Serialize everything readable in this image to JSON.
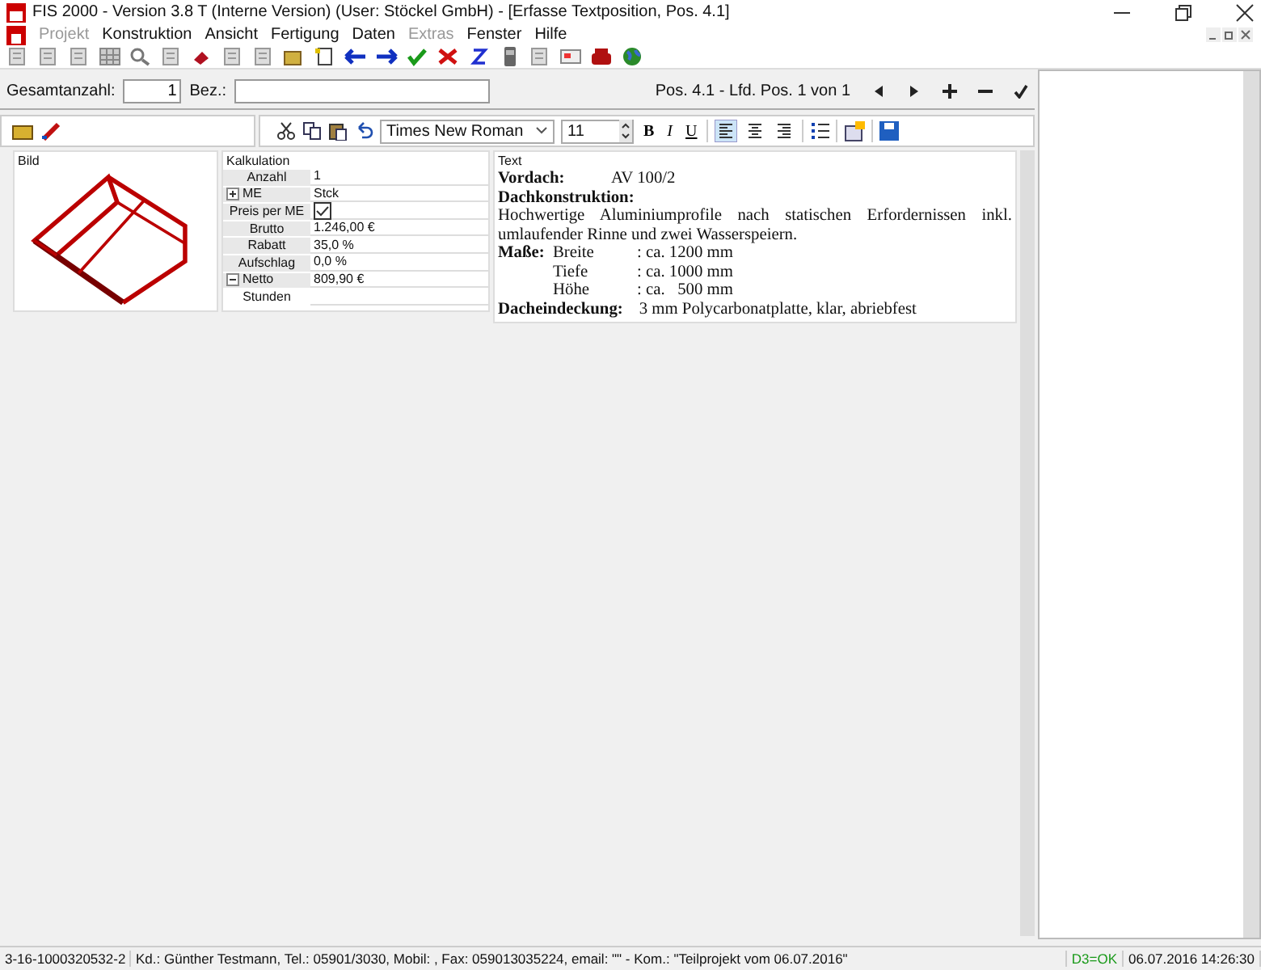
{
  "window": {
    "title": "FIS 2000 - Version 3.8 T (Interne Version) (User: Stöckel GmbH) - [Erfasse Textposition, Pos. 4.1]"
  },
  "menu": [
    {
      "label": "Projekt",
      "disabled": true
    },
    {
      "label": "Konstruktion",
      "disabled": false
    },
    {
      "label": "Ansicht",
      "disabled": false
    },
    {
      "label": "Fertigung",
      "disabled": false
    },
    {
      "label": "Daten",
      "disabled": false
    },
    {
      "label": "Extras",
      "disabled": true
    },
    {
      "label": "Fenster",
      "disabled": false
    },
    {
      "label": "Hilfe",
      "disabled": false
    }
  ],
  "form": {
    "quantity_label": "Gesamtanzahl:",
    "quantity_value": "1",
    "name_label": "Bez.:",
    "position": "Pos. 4.1 - Lfd. Pos. 1 von 1"
  },
  "format_toolbar": {
    "font": "Times New Roman",
    "size": "11",
    "styles": [
      {
        "label": "B",
        "kind": "bold"
      },
      {
        "label": "I",
        "kind": "italic"
      },
      {
        "label": "U",
        "kind": "underline"
      }
    ],
    "alignment": [
      {
        "selected": true
      },
      {
        "selected": false
      },
      {
        "selected": false
      }
    ]
  },
  "panels": {
    "image_title": "Bild",
    "calc_title": "Kalkulation",
    "text_title": "Text"
  },
  "calculation": [
    {
      "label": "Anzahl",
      "value": "1",
      "kind": "text"
    },
    {
      "label": "ME",
      "value": "Stck",
      "kind": "group",
      "expanded": false
    },
    {
      "label": "Preis per ME",
      "kind": "checkbox",
      "checked": true
    },
    {
      "label": "Brutto",
      "value": "1.246,00 €",
      "kind": "text"
    },
    {
      "label": "Rabatt",
      "value": "35,0 %",
      "kind": "text"
    },
    {
      "label": "Aufschlag",
      "value": "0,0 %",
      "kind": "text"
    },
    {
      "label": "Netto",
      "value": "809,90 €",
      "kind": "group",
      "expanded": true
    },
    {
      "label": "Stunden",
      "kind": "sub"
    }
  ],
  "text_content": [
    {
      "kind": "pair",
      "label": "Vordach:",
      "value": "AV 100/2"
    },
    {
      "kind": "heading",
      "text": "Dachkonstruktion:"
    },
    {
      "kind": "para",
      "text": "Hochwertige Aluminiumprofile nach statischen Erfordernissen inkl. umlaufender Rinne und zwei Wasserspeiern."
    },
    {
      "kind": "dim",
      "label": "Maße:",
      "name": "Breite",
      "value": ": ca. 1200 mm"
    },
    {
      "kind": "dim",
      "name": "Tiefe",
      "value": ": ca. 1000 mm"
    },
    {
      "kind": "dim",
      "name": "Höhe",
      "value": ": ca.   500 mm"
    },
    {
      "kind": "pair",
      "label": "Dacheindeckung:",
      "value": "3 mm Polycarbonatplatte, klar, abriebfest"
    }
  ],
  "status_bar": {
    "number": "3-16-1000320532-2",
    "customer": "Kd.: Günther Testmann, Tel.: 05901/3030, Mobil: , Fax: 059013035224, email: \"\" -  Kom.: \"Teilprojekt vom 06.07.2016\"",
    "db_status": "D3=OK",
    "timestamp": "06.07.2016 14:26:30"
  }
}
